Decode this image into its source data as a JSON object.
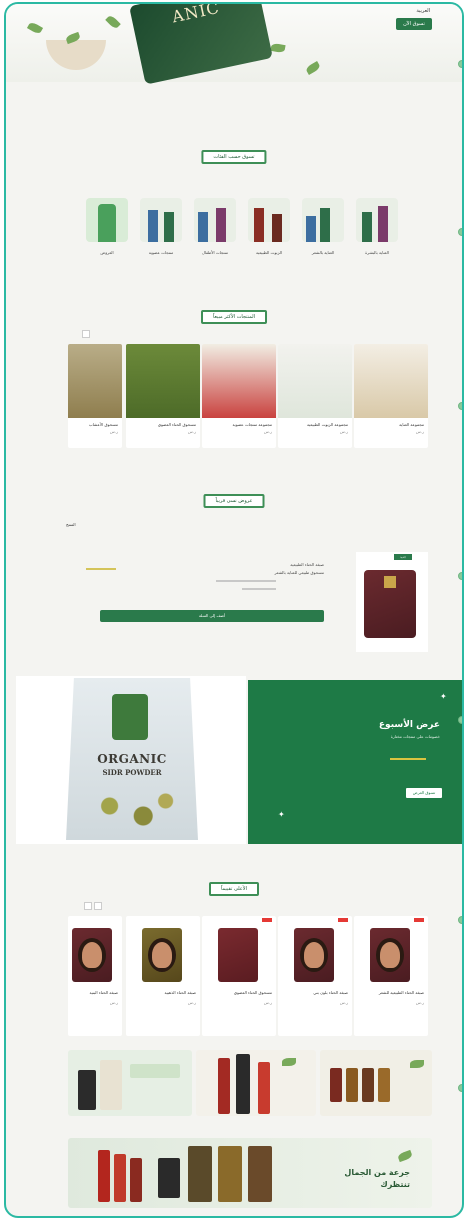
{
  "hero": {
    "link_label": "العربية",
    "button_label": "تسوق الآن",
    "pack_text": "ANIC"
  },
  "categories": {
    "title": "تسوق حسب الفئات",
    "items": [
      {
        "label": "العناية بالبشرة"
      },
      {
        "label": "العناية بالشعر"
      },
      {
        "label": "الزيوت الطبيعية"
      },
      {
        "label": "منتجات الأطفال"
      },
      {
        "label": "منتجات عضوية"
      },
      {
        "label": "العروض"
      }
    ]
  },
  "best_sellers": {
    "title": "المنتجات الأكثر مبيعاً",
    "products": [
      {
        "name": "مجموعة العناية",
        "price": "ر.س"
      },
      {
        "name": "مجموعة الزيوت الطبيعية",
        "price": "ر.س"
      },
      {
        "name": "مجموعة منتجات عضوية",
        "price": "ر.س"
      },
      {
        "name": "مسحوق الحناء العضوي",
        "price": "ر.س"
      },
      {
        "name": "مسحوق الأعشاب",
        "price": "ر.س"
      }
    ]
  },
  "featured": {
    "title": "عروض نسى قريباً",
    "small_label": "المنتج",
    "badge": "جديد",
    "line_1": "صبغة الحناء الطبيعية",
    "line_2": "مسحوق طبيعي للعناية بالشعر",
    "button_label": "أضف إلى السلة"
  },
  "deal": {
    "title": "عرض الأسبوع",
    "subtitle": "خصومات على منتجات مختارة",
    "button_label": "تسوق العرض",
    "product_title": "ORGANIC",
    "product_sub": "SIDR POWDER"
  },
  "ratings": {
    "title": "الأعلى تقييماً",
    "products": [
      {
        "name": "صبغة الحناء الطبيعية للشعر",
        "price": "ر.س"
      },
      {
        "name": "صبغة الحناء بلون بني",
        "price": "ر.س"
      },
      {
        "name": "مسحوق الحناء العضوي",
        "price": "ر.س"
      },
      {
        "name": "صبغة الحناء الذهبية",
        "price": "ر.س"
      },
      {
        "name": "صبغة الحناء البنية",
        "price": "ر.س"
      }
    ]
  },
  "banners": {
    "bottom_text_1": "جرعة من الجمال",
    "bottom_text_2": "تنتظرك"
  },
  "colors": {
    "primary": "#2a7a4b",
    "accent": "#2bb9a3",
    "deal_bg": "#1e7a46",
    "highlight": "#d9c440"
  }
}
